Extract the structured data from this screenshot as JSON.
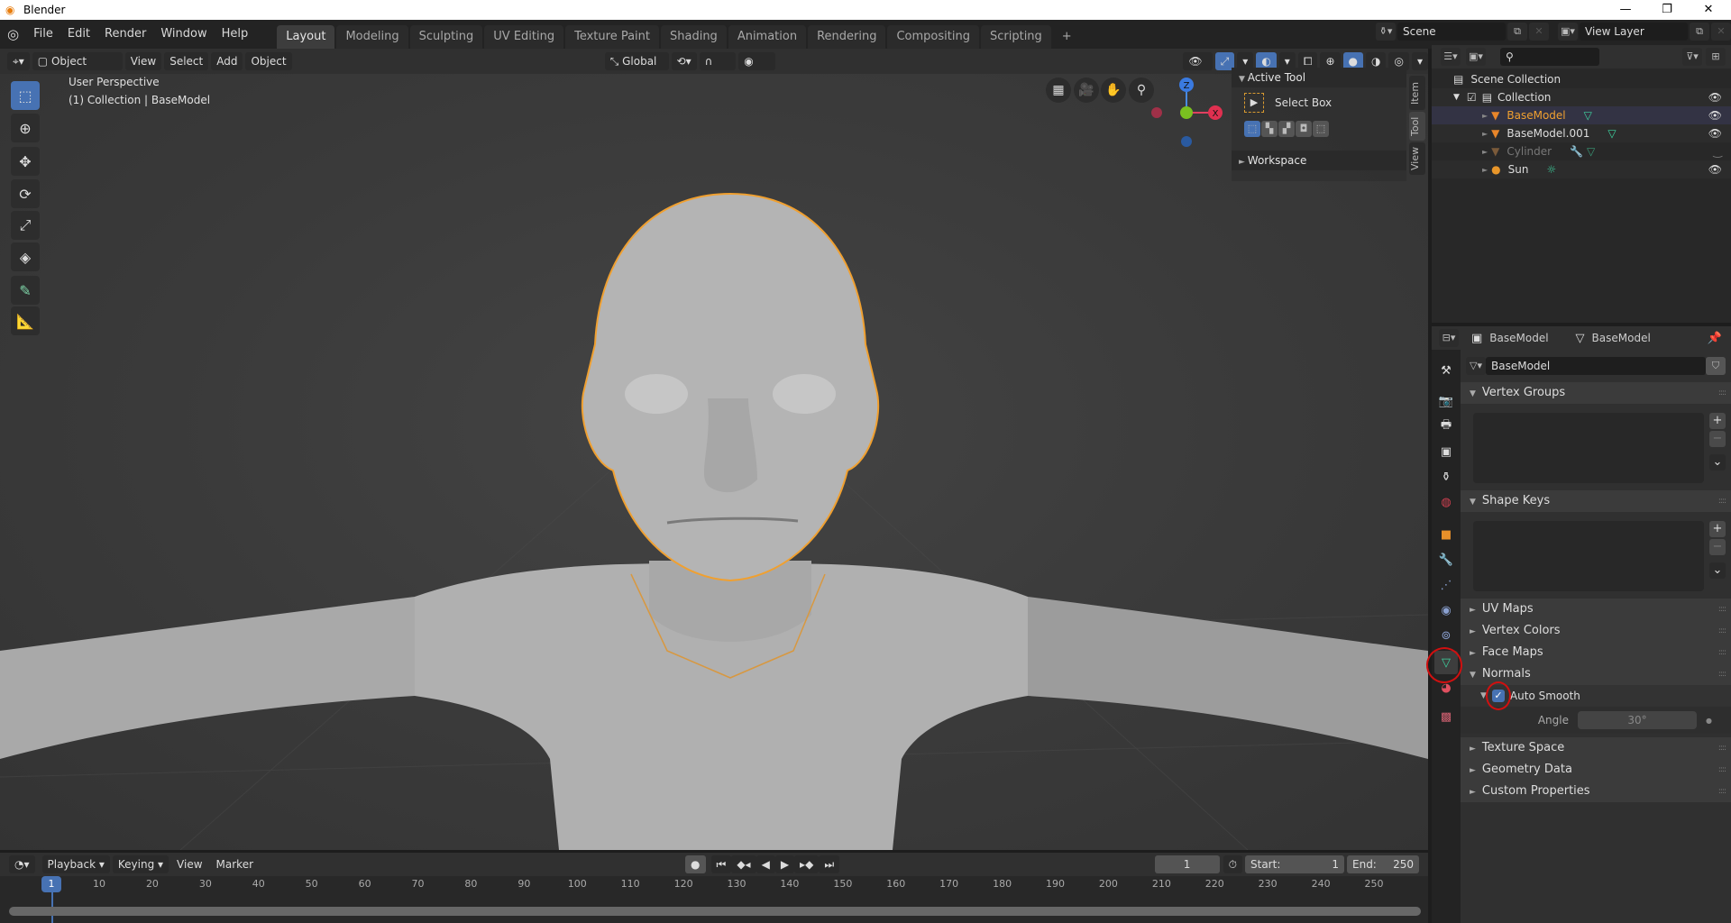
{
  "window": {
    "title": "Blender"
  },
  "menu": [
    "File",
    "Edit",
    "Render",
    "Window",
    "Help"
  ],
  "workspaces": [
    {
      "label": "Layout",
      "active": true
    },
    {
      "label": "Modeling"
    },
    {
      "label": "Sculpting"
    },
    {
      "label": "UV Editing"
    },
    {
      "label": "Texture Paint"
    },
    {
      "label": "Shading"
    },
    {
      "label": "Animation"
    },
    {
      "label": "Rendering"
    },
    {
      "label": "Compositing"
    },
    {
      "label": "Scripting"
    },
    {
      "label": "+"
    }
  ],
  "scene": {
    "name": "Scene",
    "view_layer": "View Layer"
  },
  "viewport_header": {
    "mode": "Object Mode",
    "menus": [
      "View",
      "Select",
      "Add",
      "Object"
    ],
    "orientation": "Global"
  },
  "viewport": {
    "overlay_line1": "User Perspective",
    "overlay_line2": "(1) Collection | BaseModel",
    "gizmo": {
      "z": "Z",
      "x": "X"
    }
  },
  "npanel": {
    "tabs": [
      "Item",
      "Tool",
      "View"
    ],
    "active_tool_title": "Active Tool",
    "tool_name": "Select Box",
    "workspace_title": "Workspace"
  },
  "outliner": {
    "root": "Scene Collection",
    "items": [
      {
        "name": "Collection",
        "type": "collection",
        "visible": true
      },
      {
        "name": "BaseModel",
        "type": "mesh",
        "selected": true,
        "visible": true
      },
      {
        "name": "BaseModel.001",
        "type": "mesh",
        "visible": true
      },
      {
        "name": "Cylinder",
        "type": "mesh",
        "hidden": true,
        "modifier": true
      },
      {
        "name": "Sun",
        "type": "light",
        "visible": true
      }
    ]
  },
  "properties": {
    "breadcrumb": [
      "BaseModel",
      "BaseModel"
    ],
    "datablock": "BaseModel",
    "panels": {
      "vertex_groups": "Vertex Groups",
      "shape_keys": "Shape Keys",
      "uv_maps": "UV Maps",
      "vertex_colors": "Vertex Colors",
      "face_maps": "Face Maps",
      "normals": "Normals",
      "auto_smooth": "Auto Smooth",
      "auto_smooth_checked": true,
      "angle_label": "Angle",
      "angle_value": "30°",
      "texture_space": "Texture Space",
      "geometry_data": "Geometry Data",
      "custom_properties": "Custom Properties"
    }
  },
  "timeline": {
    "menus": [
      "Playback",
      "Keying",
      "View",
      "Marker"
    ],
    "current_frame": "1",
    "start_label": "Start:",
    "start": "1",
    "end_label": "End:",
    "end": "250",
    "ticks": [
      "1",
      "10",
      "20",
      "30",
      "40",
      "50",
      "60",
      "70",
      "80",
      "90",
      "100",
      "110",
      "120",
      "130",
      "140",
      "150",
      "160",
      "170",
      "180",
      "190",
      "200",
      "210",
      "220",
      "230",
      "240",
      "250"
    ]
  },
  "colors": {
    "accent": "#4772b3",
    "selected_outline": "#f0a030",
    "annotation": "#d01010"
  }
}
